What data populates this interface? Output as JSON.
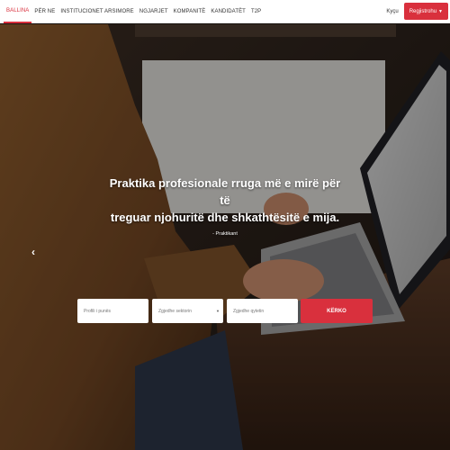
{
  "nav": {
    "items": [
      {
        "label": "BALLINA",
        "active": true
      },
      {
        "label": "PËR NE"
      },
      {
        "label": "INSTITUCIONET ARSIMORE"
      },
      {
        "label": "NGJARJET"
      },
      {
        "label": "KOMPANITË"
      },
      {
        "label": "KANDIDATËT"
      },
      {
        "label": "T2P"
      }
    ],
    "login": "Kyçu",
    "register": "Regjistrohu"
  },
  "hero": {
    "quote_line1": "Praktika profesionale rruga më e mirë për të",
    "quote_line2": "treguar njohuritë dhe shkathtësitë e mija.",
    "author": "- Praktikant"
  },
  "search": {
    "profile_placeholder": "Profili i punës",
    "sector_placeholder": "Zgjedhe sektorin",
    "city_placeholder": "Zgjedhe qytetin",
    "button": "KËRKO"
  },
  "colors": {
    "accent": "#d9303d"
  }
}
